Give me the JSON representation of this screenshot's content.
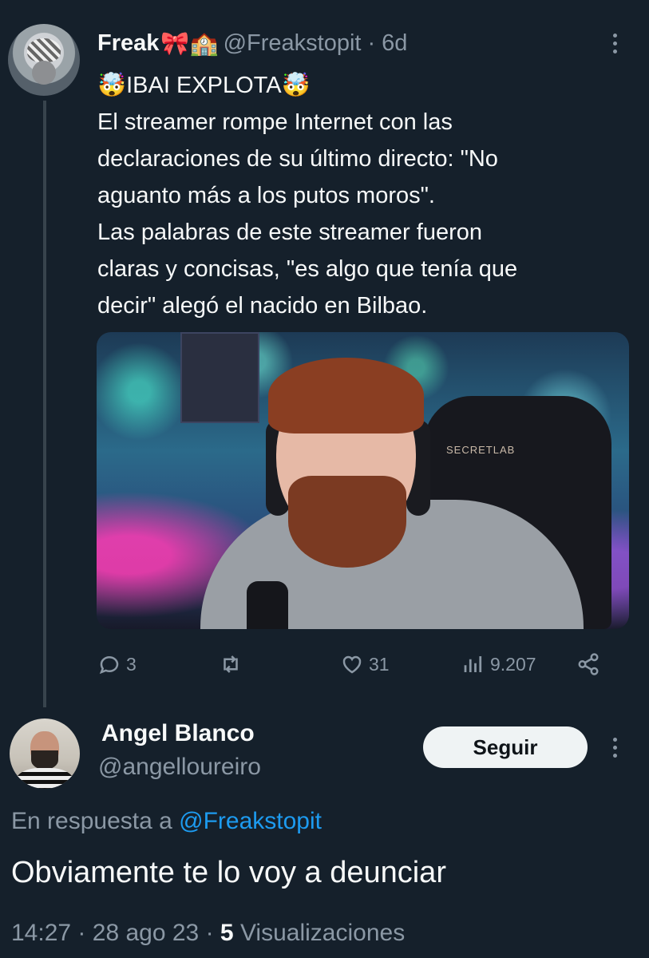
{
  "original_tweet": {
    "display_name": "Freak",
    "name_emojis": "🎀🏫",
    "handle": "@Freakstopit",
    "separator": "·",
    "time": "6d",
    "text_lines": [
      "🤯IBAI EXPLOTA🤯",
      "El streamer rompe Internet con las",
      "declaraciones de su último directo: \"No",
      "aguanto más a los putos moros\".",
      "Las palabras de este streamer fueron",
      "claras y concisas, \"es algo que tenía que",
      "decir\" alegó el nacido en Bilbao."
    ],
    "media_overlay_text": "SECRETLAB",
    "actions": {
      "replies": "3",
      "retweets": "",
      "likes": "31",
      "views": "9.207"
    }
  },
  "reply_tweet": {
    "display_name": "Angel Blanco",
    "handle": "@angelloureiro",
    "follow_label": "Seguir",
    "replying_prefix": "En respuesta a",
    "replying_to": "@Freakstopit",
    "text": "Obviamente te lo voy a deunciar",
    "meta": {
      "time": "14:27",
      "date": "28 ago 23",
      "separator": "·",
      "views_count": "5",
      "views_label": "Visualizaciones"
    }
  },
  "icons": [
    "more-icon",
    "reply-icon",
    "retweet-icon",
    "like-icon",
    "views-icon",
    "share-icon"
  ],
  "colors": {
    "background": "#15202b",
    "text_primary": "#f7f9f9",
    "text_secondary": "#8b98a5",
    "link": "#1d9bf0",
    "thread_line": "#38444d",
    "follow_button": "#eff3f4"
  }
}
